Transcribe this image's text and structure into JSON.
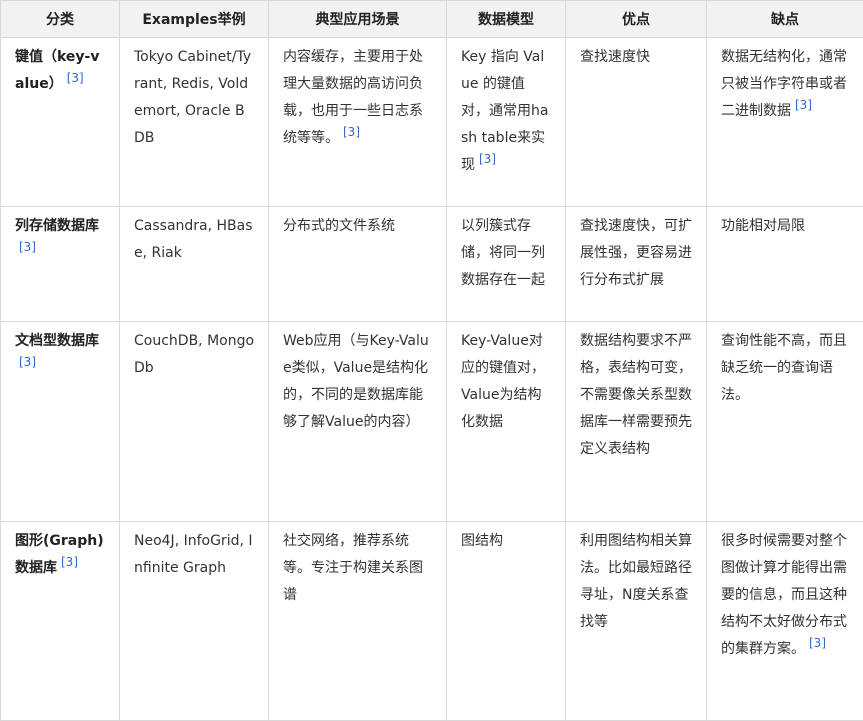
{
  "headers": [
    "分类",
    "Examples举例",
    "典型应用场景",
    "数据模型",
    "优点",
    "缺点"
  ],
  "ref_color": "#3366cc",
  "rows": [
    {
      "category": {
        "text": "键值（key-value）",
        "ref": "[3]"
      },
      "examples": {
        "text": "Tokyo Cabinet/Tyrant, Redis, Voldemort, Oracle BDB"
      },
      "scenario": {
        "text": "内容缓存，主要用于处理大量数据的高访问负载，也用于一些日志系统等等。",
        "ref": "[3]"
      },
      "model": {
        "text": "Key 指向 Value 的键值对，通常用hash table来实现",
        "ref": "[3]"
      },
      "pros": {
        "text": "查找速度快"
      },
      "cons": {
        "text": "数据无结构化，通常只被当作字符串或者二进制数据",
        "ref": "[3]"
      }
    },
    {
      "category": {
        "text": "列存储数据库",
        "ref": "[3]"
      },
      "examples": {
        "text": "Cassandra, HBase, Riak"
      },
      "scenario": {
        "text": "分布式的文件系统"
      },
      "model": {
        "text": "以列簇式存储，将同一列数据存在一起"
      },
      "pros": {
        "text": "查找速度快，可扩展性强，更容易进行分布式扩展"
      },
      "cons": {
        "text": "功能相对局限"
      }
    },
    {
      "category": {
        "text": "文档型数据库",
        "ref": "[3]"
      },
      "examples": {
        "text": "CouchDB, MongoDb"
      },
      "scenario": {
        "text": "Web应用（与Key-Value类似，Value是结构化的，不同的是数据库能够了解Value的内容）"
      },
      "model": {
        "text": "Key-Value对应的键值对，Value为结构化数据"
      },
      "pros": {
        "text": "数据结构要求不严格，表结构可变，不需要像关系型数据库一样需要预先定义表结构"
      },
      "cons": {
        "text": "查询性能不高，而且缺乏统一的查询语法。"
      }
    },
    {
      "category": {
        "text": "图形(Graph)数据库",
        "ref": "[3]"
      },
      "examples": {
        "text": "Neo4J, InfoGrid, Infinite Graph"
      },
      "scenario": {
        "text": "社交网络，推荐系统等。专注于构建关系图谱"
      },
      "model": {
        "text": "图结构"
      },
      "pros": {
        "text": "利用图结构相关算法。比如最短路径寻址，N度关系查找等"
      },
      "cons": {
        "text": "很多时候需要对整个图做计算才能得出需要的信息，而且这种结构不太好做分布式的集群方案。",
        "ref": "[3]"
      }
    }
  ]
}
